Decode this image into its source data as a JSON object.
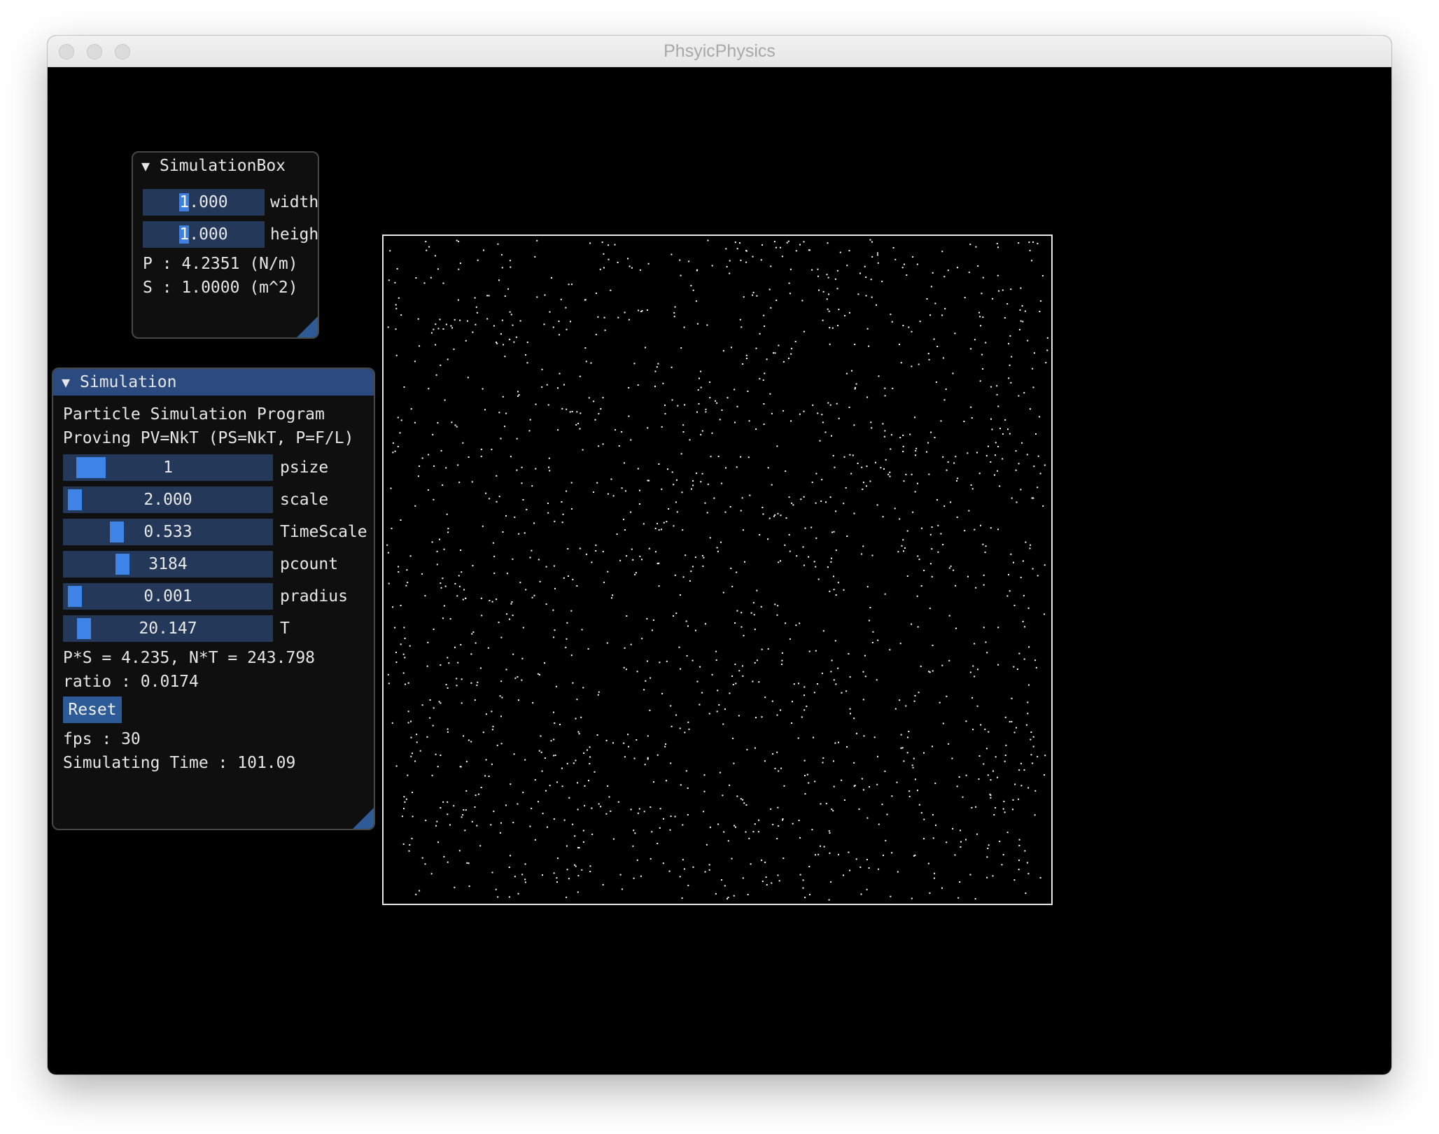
{
  "window": {
    "title": "PhsyicPhysics"
  },
  "simulation_box_panel": {
    "title": "SimulationBox",
    "width_value": "1.000",
    "width_label": "width",
    "height_value": "1.000",
    "height_label": "height",
    "pressure_text": "P : 4.2351 (N/m)",
    "area_text": "S : 1.0000 (m^2)"
  },
  "simulation_panel": {
    "title": "Simulation",
    "description_line1": "Particle Simulation Program",
    "description_line2": "Proving PV=NkT (PS=NkT, P=F/L)",
    "sliders": [
      {
        "label": "psize",
        "value": "1",
        "fraction": 0.06
      },
      {
        "label": "scale",
        "value": "2.000",
        "fraction": 0.01
      },
      {
        "label": "TimeScale",
        "value": "0.533",
        "fraction": 0.23
      },
      {
        "label": "pcount",
        "value": "3184",
        "fraction": 0.26
      },
      {
        "label": "pradius",
        "value": "0.001",
        "fraction": 0.01
      },
      {
        "label": "T",
        "value": "20.147",
        "fraction": 0.06
      }
    ],
    "ps_nt_text": "P*S = 4.235, N*T = 243.798",
    "ratio_text": "ratio : 0.0174",
    "reset_label": "Reset",
    "fps_text": "fps : 30",
    "sim_time_text": "Simulating Time : 101.09"
  },
  "colors": {
    "panel_bg": "#0f0f0f",
    "header_active": "#2b4a80",
    "frame_bg": "#24395a",
    "accent": "#3d84e6",
    "button": "#2d5b98",
    "particle": "#ffffff"
  }
}
